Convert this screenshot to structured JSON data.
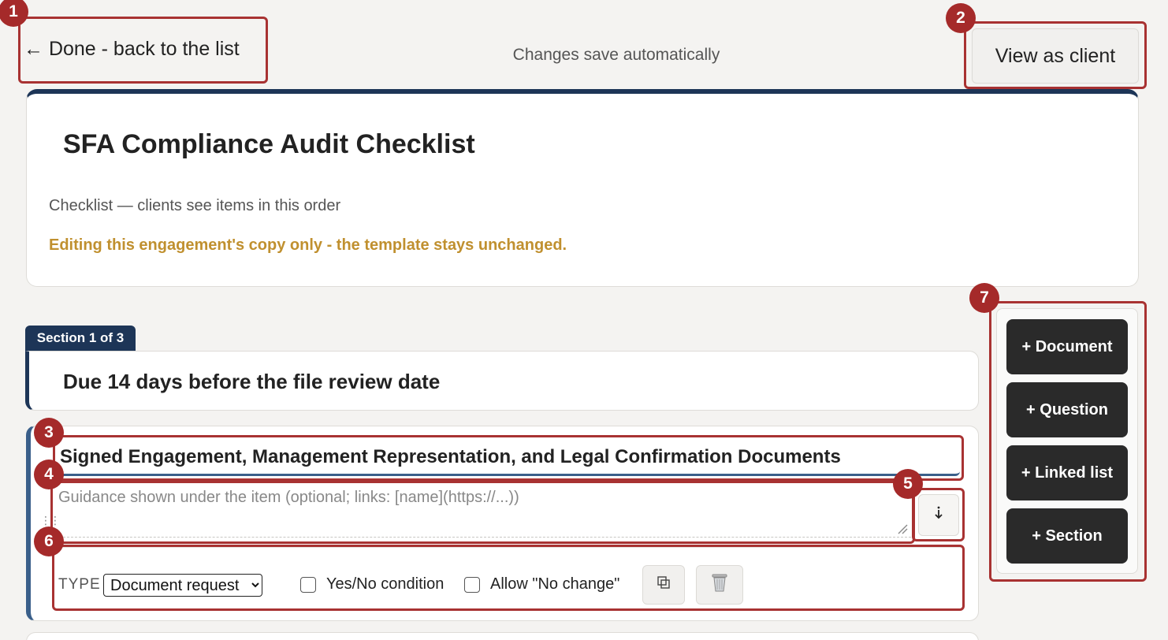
{
  "top_bar": {
    "back_label": "← Done - back to the list",
    "save_status": "Changes save automatically",
    "view_as_client_label": "View as client"
  },
  "header": {
    "title": "SFA Compliance Audit Checklist",
    "description": "Checklist — clients see items in this order",
    "warning": "Editing this engagement's copy only - the template stays unchanged.",
    "accent_color": "#1d3557",
    "warning_color": "#c0902f"
  },
  "section": {
    "tag": "Section 1 of 3",
    "title": "Due 14 days before the file review date"
  },
  "item": {
    "title": "Signed Engagement, Management Representation, and Legal Confirmation Documents",
    "guidance_value": "",
    "guidance_placeholder": "Guidance shown under the item (optional; links: [name](https://...))",
    "move_down_icon": "arrow-down-icon",
    "type_label": "TYPE",
    "type_selected": "Document request",
    "yes_no_label": "Yes/No condition",
    "yes_no_checked": false,
    "allow_no_change_label": "Allow \"No change\"",
    "allow_no_change_checked": false,
    "duplicate_icon": "duplicate-icon",
    "delete_icon": "trash-icon"
  },
  "add_panel": {
    "buttons": [
      {
        "label": "+ Document"
      },
      {
        "label": "+ Question"
      },
      {
        "label": "+ Linked list"
      },
      {
        "label": "+ Section"
      }
    ]
  },
  "annotations": [
    "1",
    "2",
    "3",
    "4",
    "5",
    "6",
    "7"
  ],
  "colors": {
    "annotation": "#a52a2a",
    "button_dark": "#2a2a2a",
    "page_bg": "#f4f3f1"
  }
}
